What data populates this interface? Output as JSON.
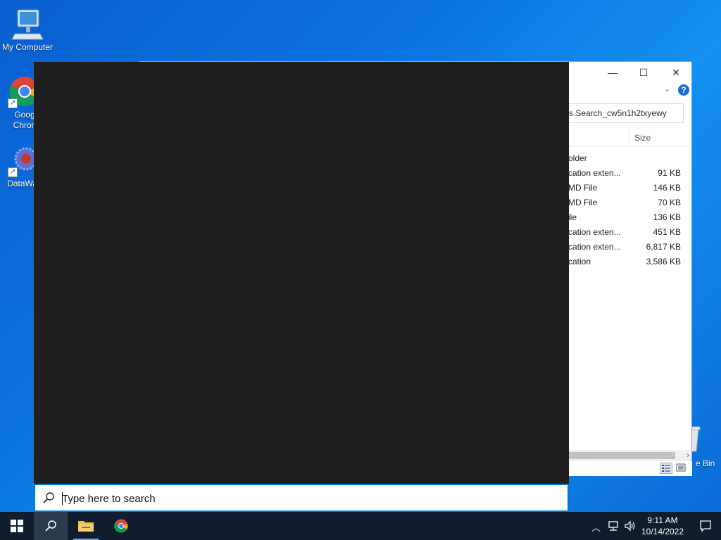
{
  "desktop": {
    "icons": [
      {
        "label": "My Computer"
      },
      {
        "label": "Goog\nChron"
      },
      {
        "label": "DataWag"
      }
    ],
    "recycle_label": "e Bin"
  },
  "explorer": {
    "address_text": "s.Search_cw5n1h2txyewy",
    "size_header": "Size",
    "rows": [
      {
        "type": "older",
        "size": ""
      },
      {
        "type": "cation exten...",
        "size": "91 KB"
      },
      {
        "type": "MD File",
        "size": "146 KB"
      },
      {
        "type": "MD File",
        "size": "70 KB"
      },
      {
        "type": "ile",
        "size": "136 KB"
      },
      {
        "type": "cation exten...",
        "size": "451 KB"
      },
      {
        "type": "cation exten...",
        "size": "6,817 KB"
      },
      {
        "type": "cation",
        "size": "3,586 KB"
      }
    ],
    "help_glyph": "?"
  },
  "search": {
    "placeholder": "Type here to search"
  },
  "taskbar": {
    "time": "9:11 AM",
    "date": "10/14/2022"
  },
  "colors": {
    "accent": "#0078d7",
    "taskbar": "#101d2e",
    "search_panel": "#1f1f1f"
  }
}
